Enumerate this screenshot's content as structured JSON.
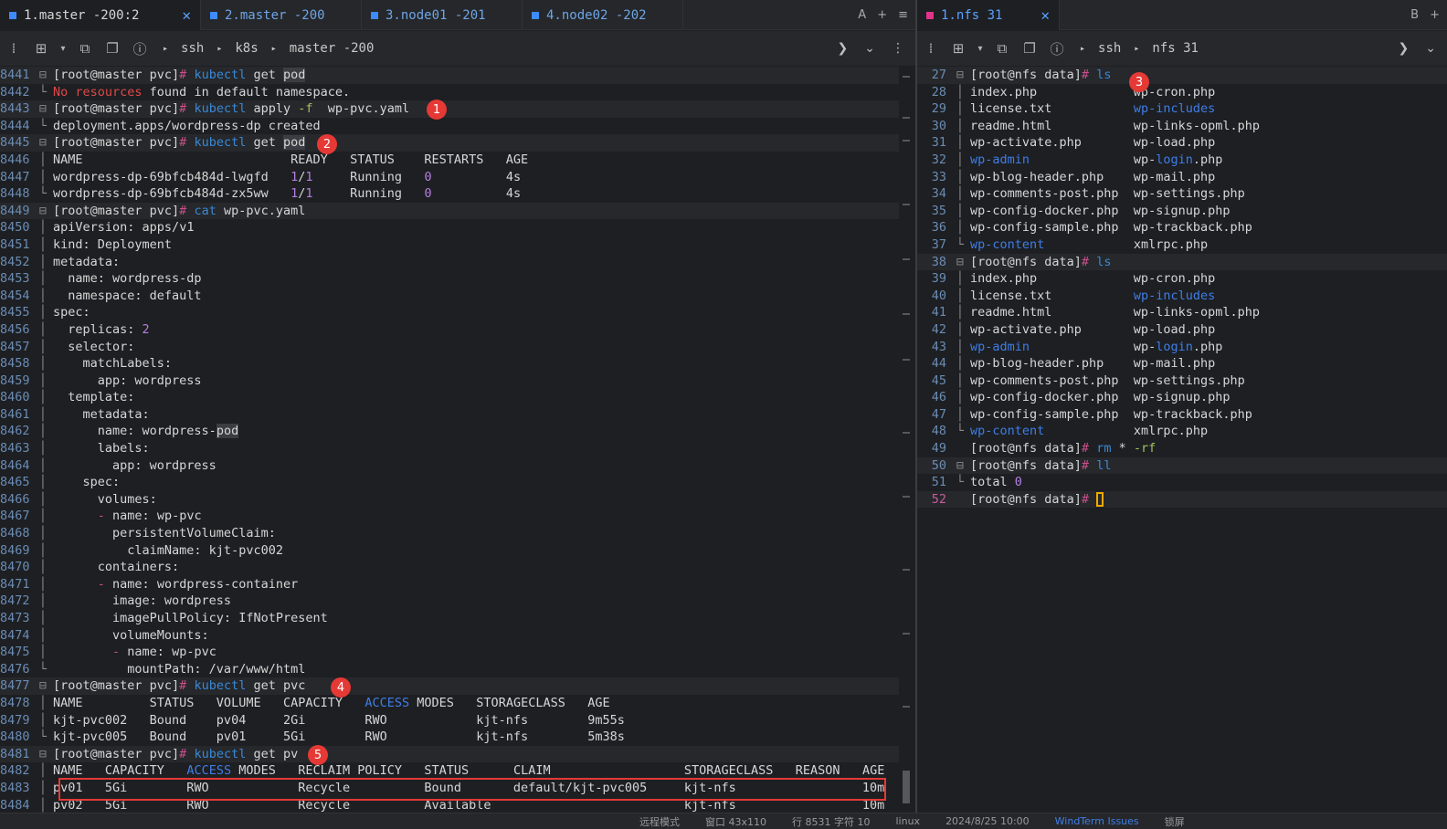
{
  "left": {
    "tabs": [
      {
        "label": "1.master -200:2",
        "active": true
      },
      {
        "label": "2.master -200",
        "active": false
      },
      {
        "label": "3.node01 -201",
        "active": false
      },
      {
        "label": "4.node02 -202",
        "active": false
      }
    ],
    "tab_tools": [
      "A",
      "+",
      "≡"
    ],
    "breadcrumbs": [
      "ssh",
      "k8s",
      "master -200"
    ],
    "lines": [
      {
        "n": "8441",
        "f": "⊟",
        "hl": true,
        "s": [
          [
            "[root@master pvc]",
            ""
          ],
          [
            "# ",
            "op"
          ],
          [
            "kubectl",
            "cmd"
          ],
          [
            " get ",
            ""
          ],
          [
            "pod",
            "hi"
          ]
        ]
      },
      {
        "n": "8442",
        "f": "└",
        "s": [
          [
            "No resources",
            "red"
          ],
          [
            " found in default namespace.",
            ""
          ]
        ]
      },
      {
        "n": "8443",
        "f": "⊟",
        "hl": true,
        "s": [
          [
            "[root@master pvc]",
            ""
          ],
          [
            "# ",
            "op"
          ],
          [
            "kubectl",
            "cmd"
          ],
          [
            " apply ",
            ""
          ],
          [
            "-f",
            "kw"
          ],
          [
            "  wp-pvc.yaml",
            ""
          ]
        ]
      },
      {
        "n": "8444",
        "f": "└",
        "s": [
          [
            "deployment.apps/wordpress-dp created",
            ""
          ]
        ]
      },
      {
        "n": "8445",
        "f": "⊟",
        "hl": true,
        "s": [
          [
            "[root@master pvc]",
            ""
          ],
          [
            "# ",
            "op"
          ],
          [
            "kubectl",
            "cmd"
          ],
          [
            " get ",
            ""
          ],
          [
            "pod",
            "hi"
          ]
        ]
      },
      {
        "n": "8446",
        "f": "│",
        "s": [
          [
            "NAME                            READY   STATUS    RESTARTS   AGE",
            ""
          ]
        ]
      },
      {
        "n": "8447",
        "f": "│",
        "s": [
          [
            "wordpress-dp-69bfcb484d-lwgfd   ",
            ""
          ],
          [
            "1",
            "num"
          ],
          [
            "/",
            ""
          ],
          [
            "1",
            "num"
          ],
          [
            "     Running   ",
            ""
          ],
          [
            "0",
            "num"
          ],
          [
            "          4s",
            ""
          ]
        ]
      },
      {
        "n": "8448",
        "f": "└",
        "s": [
          [
            "wordpress-dp-69bfcb484d-zx5ww   ",
            ""
          ],
          [
            "1",
            "num"
          ],
          [
            "/",
            ""
          ],
          [
            "1",
            "num"
          ],
          [
            "     Running   ",
            ""
          ],
          [
            "0",
            "num"
          ],
          [
            "          4s",
            ""
          ]
        ]
      },
      {
        "n": "8449",
        "f": "⊟",
        "hl": true,
        "s": [
          [
            "[root@master pvc]",
            ""
          ],
          [
            "# ",
            "op"
          ],
          [
            "cat",
            "cmd"
          ],
          [
            " wp-pvc.yaml",
            ""
          ]
        ]
      },
      {
        "n": "8450",
        "f": "│",
        "s": [
          [
            "apiVersion",
            ""
          ],
          [
            ":",
            ""
          ],
          [
            " apps/v1",
            ""
          ]
        ]
      },
      {
        "n": "8451",
        "f": "│",
        "s": [
          [
            "kind: Deployment",
            ""
          ]
        ]
      },
      {
        "n": "8452",
        "f": "│",
        "s": [
          [
            "metadata:",
            ""
          ]
        ]
      },
      {
        "n": "8453",
        "f": "│",
        "s": [
          [
            "  name: wordpress-dp",
            ""
          ]
        ]
      },
      {
        "n": "8454",
        "f": "│",
        "s": [
          [
            "  namespace: default",
            ""
          ]
        ]
      },
      {
        "n": "8455",
        "f": "│",
        "s": [
          [
            "spec:",
            ""
          ]
        ]
      },
      {
        "n": "8456",
        "f": "│",
        "s": [
          [
            "  replicas: ",
            ""
          ],
          [
            "2",
            "num"
          ]
        ]
      },
      {
        "n": "8457",
        "f": "│",
        "s": [
          [
            "  selector:",
            ""
          ]
        ]
      },
      {
        "n": "8458",
        "f": "│",
        "s": [
          [
            "    matchLabels:",
            ""
          ]
        ]
      },
      {
        "n": "8459",
        "f": "│",
        "s": [
          [
            "      app: wordpress",
            ""
          ]
        ]
      },
      {
        "n": "8460",
        "f": "│",
        "s": [
          [
            "  template:",
            ""
          ]
        ]
      },
      {
        "n": "8461",
        "f": "│",
        "s": [
          [
            "    metadata:",
            ""
          ]
        ]
      },
      {
        "n": "8462",
        "f": "│",
        "s": [
          [
            "      name: wordpress-",
            ""
          ],
          [
            "pod",
            "hi"
          ]
        ]
      },
      {
        "n": "8463",
        "f": "│",
        "s": [
          [
            "      labels:",
            ""
          ]
        ]
      },
      {
        "n": "8464",
        "f": "│",
        "s": [
          [
            "        app: wordpress",
            ""
          ]
        ]
      },
      {
        "n": "8465",
        "f": "│",
        "s": [
          [
            "    spec:",
            ""
          ]
        ]
      },
      {
        "n": "8466",
        "f": "│",
        "s": [
          [
            "      volumes:",
            ""
          ]
        ]
      },
      {
        "n": "8467",
        "f": "│",
        "s": [
          [
            "      ",
            "",
            ""
          ],
          [
            "-",
            "op"
          ],
          [
            " name: wp-pvc",
            ""
          ]
        ]
      },
      {
        "n": "8468",
        "f": "│",
        "s": [
          [
            "        persistentVolumeClaim:",
            ""
          ]
        ]
      },
      {
        "n": "8469",
        "f": "│",
        "s": [
          [
            "          claimName: kjt-pvc002",
            ""
          ]
        ]
      },
      {
        "n": "8470",
        "f": "│",
        "s": [
          [
            "      containers:",
            ""
          ]
        ]
      },
      {
        "n": "8471",
        "f": "│",
        "s": [
          [
            "      ",
            ""
          ],
          [
            "-",
            "op"
          ],
          [
            " name: wordpress-container",
            ""
          ]
        ]
      },
      {
        "n": "8472",
        "f": "│",
        "s": [
          [
            "        image: wordpress",
            ""
          ]
        ]
      },
      {
        "n": "8473",
        "f": "│",
        "s": [
          [
            "        imagePullPolicy: IfNotPresent",
            ""
          ]
        ]
      },
      {
        "n": "8474",
        "f": "│",
        "s": [
          [
            "        volumeMounts:",
            ""
          ]
        ]
      },
      {
        "n": "8475",
        "f": "│",
        "s": [
          [
            "        ",
            ""
          ],
          [
            "-",
            "op"
          ],
          [
            " name: wp-pvc",
            ""
          ]
        ]
      },
      {
        "n": "8476",
        "f": "└",
        "s": [
          [
            "          mountPath: /var/www/html",
            ""
          ]
        ]
      },
      {
        "n": "8477",
        "f": "⊟",
        "hl": true,
        "s": [
          [
            "[root@master pvc]",
            ""
          ],
          [
            "# ",
            "op"
          ],
          [
            "kubectl",
            "cmd"
          ],
          [
            " get pvc",
            ""
          ]
        ]
      },
      {
        "n": "8478",
        "f": "│",
        "s": [
          [
            "NAME         STATUS   VOLUME   CAPACITY   ",
            ""
          ],
          [
            "ACCESS",
            "blu"
          ],
          [
            " MODES   STORAGECLASS   AGE",
            ""
          ]
        ]
      },
      {
        "n": "8479",
        "f": "│",
        "s": [
          [
            "kjt-pvc002   Bound    pv04     2Gi        RWO            kjt-nfs        9m55s",
            ""
          ]
        ]
      },
      {
        "n": "8480",
        "f": "└",
        "s": [
          [
            "kjt-pvc005   Bound    pv01     5Gi        RWO            kjt-nfs        5m38s",
            ""
          ]
        ]
      },
      {
        "n": "8481",
        "f": "⊟",
        "hl": true,
        "s": [
          [
            "[root@master pvc]",
            ""
          ],
          [
            "# ",
            "op"
          ],
          [
            "kubectl",
            "cmd"
          ],
          [
            " get pv",
            ""
          ]
        ]
      },
      {
        "n": "8482",
        "f": "│",
        "s": [
          [
            "NAME   CAPACITY   ",
            ""
          ],
          [
            "ACCESS",
            "blu"
          ],
          [
            " MODES   RECLAIM POLICY   STATUS      CLAIM                  STORAGECLASS   REASON   AGE",
            ""
          ]
        ]
      },
      {
        "n": "8483",
        "f": "│",
        "s": [
          [
            "pv01   5Gi        RWO            Recycle          Bound       default/kjt-pvc005     kjt-nfs                 10m",
            ""
          ]
        ]
      },
      {
        "n": "8484",
        "f": "│",
        "s": [
          [
            "pv02   5Gi        RWO            Recycle          Available                          kjt-nfs                 10m",
            ""
          ]
        ]
      }
    ],
    "badges": [
      "1",
      "2",
      "4",
      "5"
    ]
  },
  "right": {
    "tabs": [
      {
        "label": "1.nfs 31",
        "active": true
      }
    ],
    "tab_tools": [
      "B",
      "+"
    ],
    "breadcrumbs": [
      "ssh",
      "nfs 31"
    ],
    "lines": [
      {
        "n": "27",
        "f": "⊟",
        "hl": true,
        "s": [
          [
            "[root@nfs data]",
            ""
          ],
          [
            "# ",
            "op"
          ],
          [
            "ls",
            "cmd"
          ]
        ]
      },
      {
        "n": "28",
        "f": "│",
        "s": [
          [
            "index.php             wp-cron.php",
            ""
          ]
        ]
      },
      {
        "n": "29",
        "f": "│",
        "s": [
          [
            "license.txt           ",
            ""
          ],
          [
            "wp-includes",
            "blu"
          ]
        ]
      },
      {
        "n": "30",
        "f": "│",
        "s": [
          [
            "readme.html           wp-links-opml.php",
            ""
          ]
        ]
      },
      {
        "n": "31",
        "f": "│",
        "s": [
          [
            "wp-activate.php       wp-load.php",
            ""
          ]
        ]
      },
      {
        "n": "32",
        "f": "│",
        "s": [
          [
            "wp-admin",
            "blu"
          ],
          [
            "              wp-",
            ""
          ],
          [
            "login",
            "blu"
          ],
          [
            ".php",
            ""
          ]
        ]
      },
      {
        "n": "33",
        "f": "│",
        "s": [
          [
            "wp-blog-header.php    wp-mail.php",
            ""
          ]
        ]
      },
      {
        "n": "34",
        "f": "│",
        "s": [
          [
            "wp-comments-post.php  wp-settings.php",
            ""
          ]
        ]
      },
      {
        "n": "35",
        "f": "│",
        "s": [
          [
            "wp-config-docker.php  wp-signup.php",
            ""
          ]
        ]
      },
      {
        "n": "36",
        "f": "│",
        "s": [
          [
            "wp-config-sample.php  wp-trackback.php",
            ""
          ]
        ]
      },
      {
        "n": "37",
        "f": "└",
        "s": [
          [
            "wp-content",
            "blu"
          ],
          [
            "            xmlrpc.php",
            ""
          ]
        ]
      },
      {
        "n": "38",
        "f": "⊟",
        "hl": true,
        "s": [
          [
            "[root@nfs data]",
            ""
          ],
          [
            "# ",
            "op"
          ],
          [
            "ls",
            "cmd"
          ]
        ]
      },
      {
        "n": "39",
        "f": "│",
        "s": [
          [
            "index.php             wp-cron.php",
            ""
          ]
        ]
      },
      {
        "n": "40",
        "f": "│",
        "s": [
          [
            "license.txt           ",
            ""
          ],
          [
            "wp-includes",
            "blu"
          ]
        ]
      },
      {
        "n": "41",
        "f": "│",
        "s": [
          [
            "readme.html           wp-links-opml.php",
            ""
          ]
        ]
      },
      {
        "n": "42",
        "f": "│",
        "s": [
          [
            "wp-activate.php       wp-load.php",
            ""
          ]
        ]
      },
      {
        "n": "43",
        "f": "│",
        "s": [
          [
            "wp-admin",
            "blu"
          ],
          [
            "              wp-",
            ""
          ],
          [
            "login",
            "blu"
          ],
          [
            ".php",
            ""
          ]
        ]
      },
      {
        "n": "44",
        "f": "│",
        "s": [
          [
            "wp-blog-header.php    wp-mail.php",
            ""
          ]
        ]
      },
      {
        "n": "45",
        "f": "│",
        "s": [
          [
            "wp-comments-post.php  wp-settings.php",
            ""
          ]
        ]
      },
      {
        "n": "46",
        "f": "│",
        "s": [
          [
            "wp-config-docker.php  wp-signup.php",
            ""
          ]
        ]
      },
      {
        "n": "47",
        "f": "│",
        "s": [
          [
            "wp-config-sample.php  wp-trackback.php",
            ""
          ]
        ]
      },
      {
        "n": "48",
        "f": "└",
        "s": [
          [
            "wp-content",
            "blu"
          ],
          [
            "            xmlrpc.php",
            ""
          ]
        ]
      },
      {
        "n": "49",
        "f": " ",
        "s": [
          [
            "[root@nfs data]",
            ""
          ],
          [
            "# ",
            "op"
          ],
          [
            "rm",
            "cmd"
          ],
          [
            " * ",
            ""
          ],
          [
            "-rf",
            "kw"
          ]
        ]
      },
      {
        "n": "50",
        "f": "⊟",
        "hl": true,
        "s": [
          [
            "[root@nfs data]",
            ""
          ],
          [
            "# ",
            "op"
          ],
          [
            "ll",
            "cmd"
          ]
        ]
      },
      {
        "n": "51",
        "f": "└",
        "s": [
          [
            "total ",
            ""
          ],
          [
            "0",
            "num"
          ]
        ]
      },
      {
        "n": "52",
        "f": " ",
        "cur": true,
        "hl": true,
        "s": [
          [
            "[root@nfs data]",
            ""
          ],
          [
            "# ",
            "op"
          ]
        ]
      }
    ],
    "badges": [
      "3"
    ]
  },
  "statusbar": {
    "items": [
      "远程模式",
      "窗口 43x110",
      "行 8531 字符 10",
      "linux",
      "2024/8/25 10:00"
    ],
    "link": "WindTerm Issues",
    "tail": "锁屏"
  }
}
